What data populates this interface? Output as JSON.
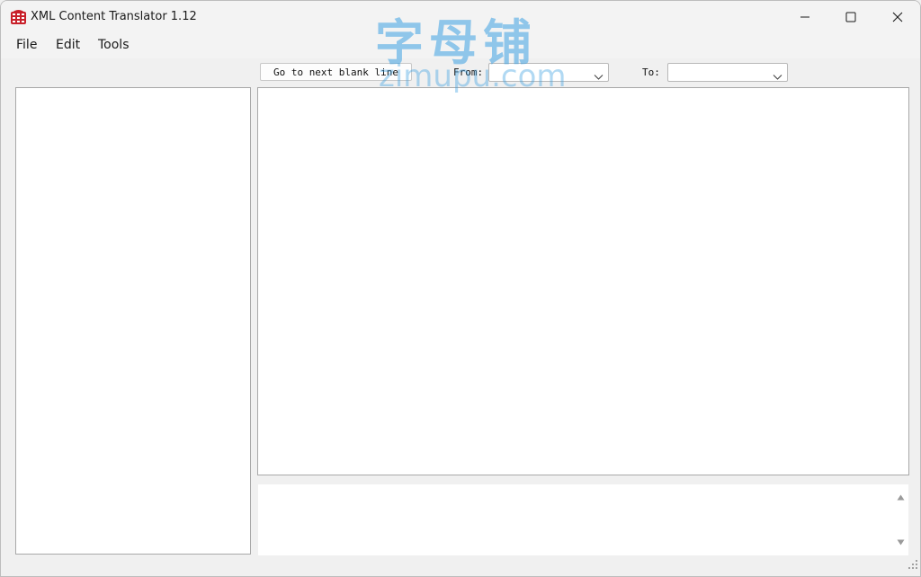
{
  "window": {
    "title": "XML Content Translator 1.12"
  },
  "menu": {
    "items": [
      {
        "label": "File"
      },
      {
        "label": "Edit"
      },
      {
        "label": "Tools"
      }
    ]
  },
  "toolbar": {
    "next_blank_label": "Go to next blank line",
    "from_label": "From:",
    "from_value": "",
    "to_label": "To:",
    "to_value": ""
  },
  "watermark": {
    "chinese": "字母铺",
    "latin": "zimupu.com"
  },
  "icons": {
    "app": "app-logo-icon",
    "minimize": "minimize-icon",
    "maximize": "maximize-icon",
    "close": "close-icon",
    "dropdown": "chevron-down-icon",
    "scroll_up": "scroll-up-icon",
    "scroll_down": "scroll-down-icon",
    "resize": "resize-grip-icon"
  },
  "colors": {
    "titlebar": "#f3f3f3",
    "window_bg": "#f0f0f0",
    "panel_bg": "#ffffff",
    "app_icon": "#c8202a",
    "watermark": "#3ca0e1"
  }
}
